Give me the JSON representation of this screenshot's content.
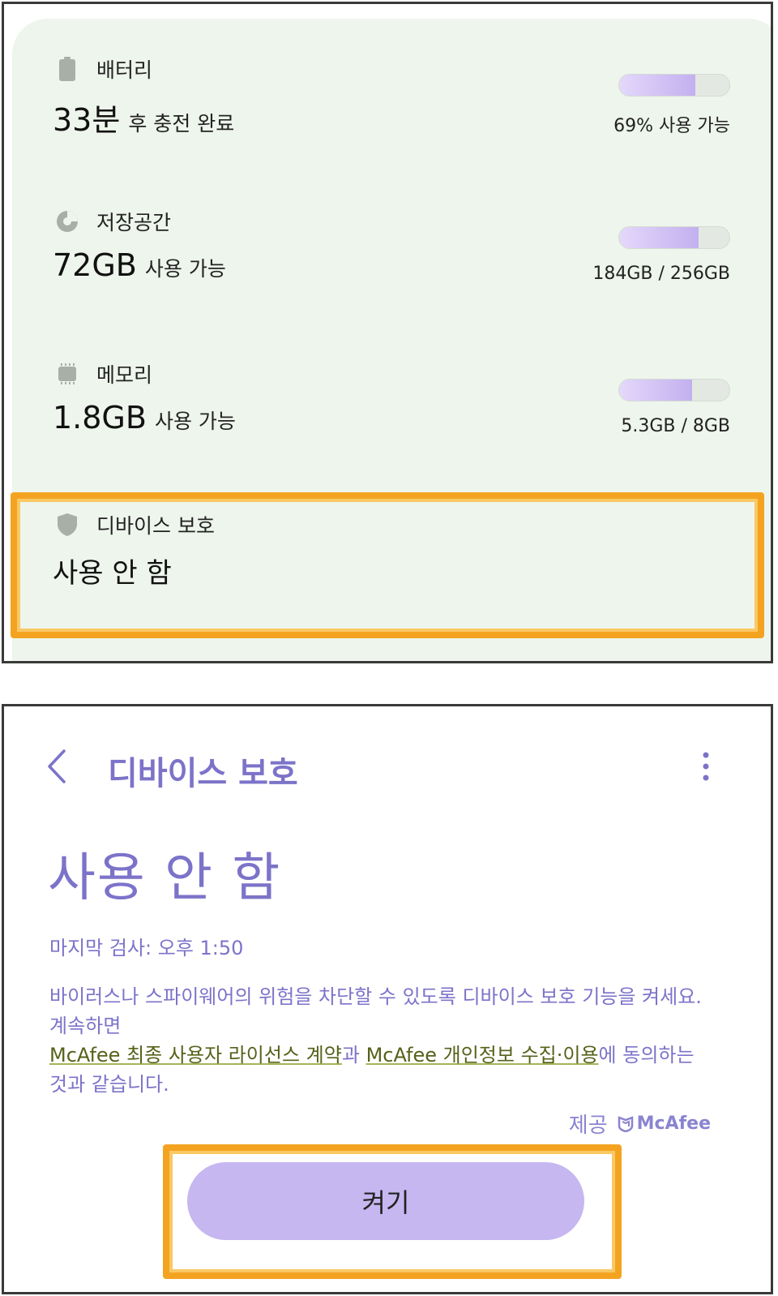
{
  "care": {
    "battery": {
      "label": "배터리",
      "value": "33분",
      "value_suffix": "후 충전 완료",
      "detail": "69% 사용 가능",
      "level_percent": 69,
      "icon": "battery-icon"
    },
    "storage": {
      "label": "저장공간",
      "value": "72GB",
      "value_suffix": "사용 가능",
      "detail": "184GB / 256GB",
      "used_fraction": 0.72,
      "icon": "pie-chart-icon"
    },
    "memory": {
      "label": "메모리",
      "value": "1.8GB",
      "value_suffix": "사용 가능",
      "detail": "5.3GB / 8GB",
      "used_fraction": 0.66,
      "icon": "memory-chip-icon"
    },
    "protection": {
      "label": "디바이스 보호",
      "value": "사용 안 함",
      "icon": "shield-icon"
    }
  },
  "detail_screen": {
    "title": "디바이스 보호",
    "status": "사용 안 함",
    "last_scan": "마지막 검사: 오후 1:50",
    "desc_line1": "바이러스나 스파이웨어의 위험을 차단할 수 있도록 디바이스 보호 기능을 켜세요.",
    "desc_line2": "계속하면",
    "link_eula": "McAfee 최종 사용자 라이선스 계약",
    "and": "과 ",
    "link_privacy": "McAfee 개인정보 수집·이용",
    "desc_line3a": "에 동의하는",
    "desc_line3b": "것과 같습니다.",
    "provided_by": "제공",
    "provider_logo_text": "McAfee",
    "button_label": "켜기"
  },
  "colors": {
    "accent": "#7c73c9",
    "highlight": "#f4a321",
    "card_bg": "#eef5ec",
    "button_bg": "#c6b7f0"
  }
}
